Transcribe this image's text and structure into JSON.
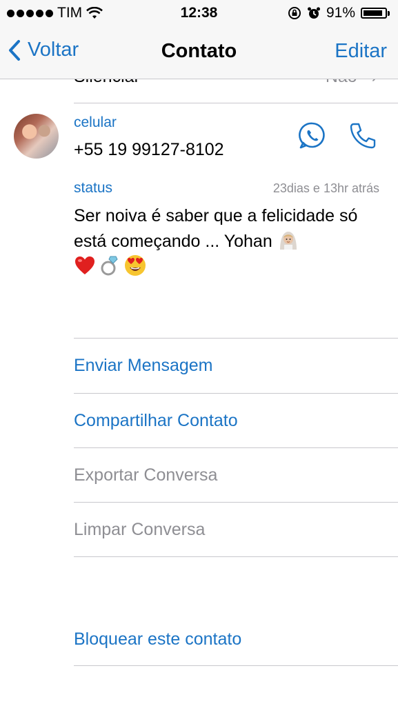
{
  "status_bar": {
    "carrier": "TIM",
    "time": "12:38",
    "battery_percent": "91%",
    "battery_level": 0.91,
    "icons": [
      "signal-dots-icon",
      "wifi-icon",
      "rotation-lock-icon",
      "alarm-icon",
      "battery-icon"
    ]
  },
  "nav": {
    "back_label": "Voltar",
    "title": "Contato",
    "edit_label": "Editar"
  },
  "cut_row": {
    "label": "Silenciar",
    "value": "Não"
  },
  "contact": {
    "phone_label": "celular",
    "phone": "+55 19 99127-8102",
    "status_label": "status",
    "status_date": "23dias e 13hr atrás",
    "status_text": "Ser noiva é saber que a felicidade só está começando ... Yohan",
    "status_emojis": [
      "bride-emoji",
      "heart-emoji",
      "ring-emoji",
      "heart-eyes-emoji"
    ]
  },
  "actions": {
    "send_message": "Enviar Mensagem",
    "share_contact": "Compartilhar Contato",
    "export_chat": "Exportar Conversa",
    "clear_chat": "Limpar Conversa",
    "block_contact": "Bloquear este contato"
  },
  "colors": {
    "accent": "#1b74c5",
    "secondary_text": "#8e8e93",
    "bar_bg": "#f7f7f7"
  }
}
